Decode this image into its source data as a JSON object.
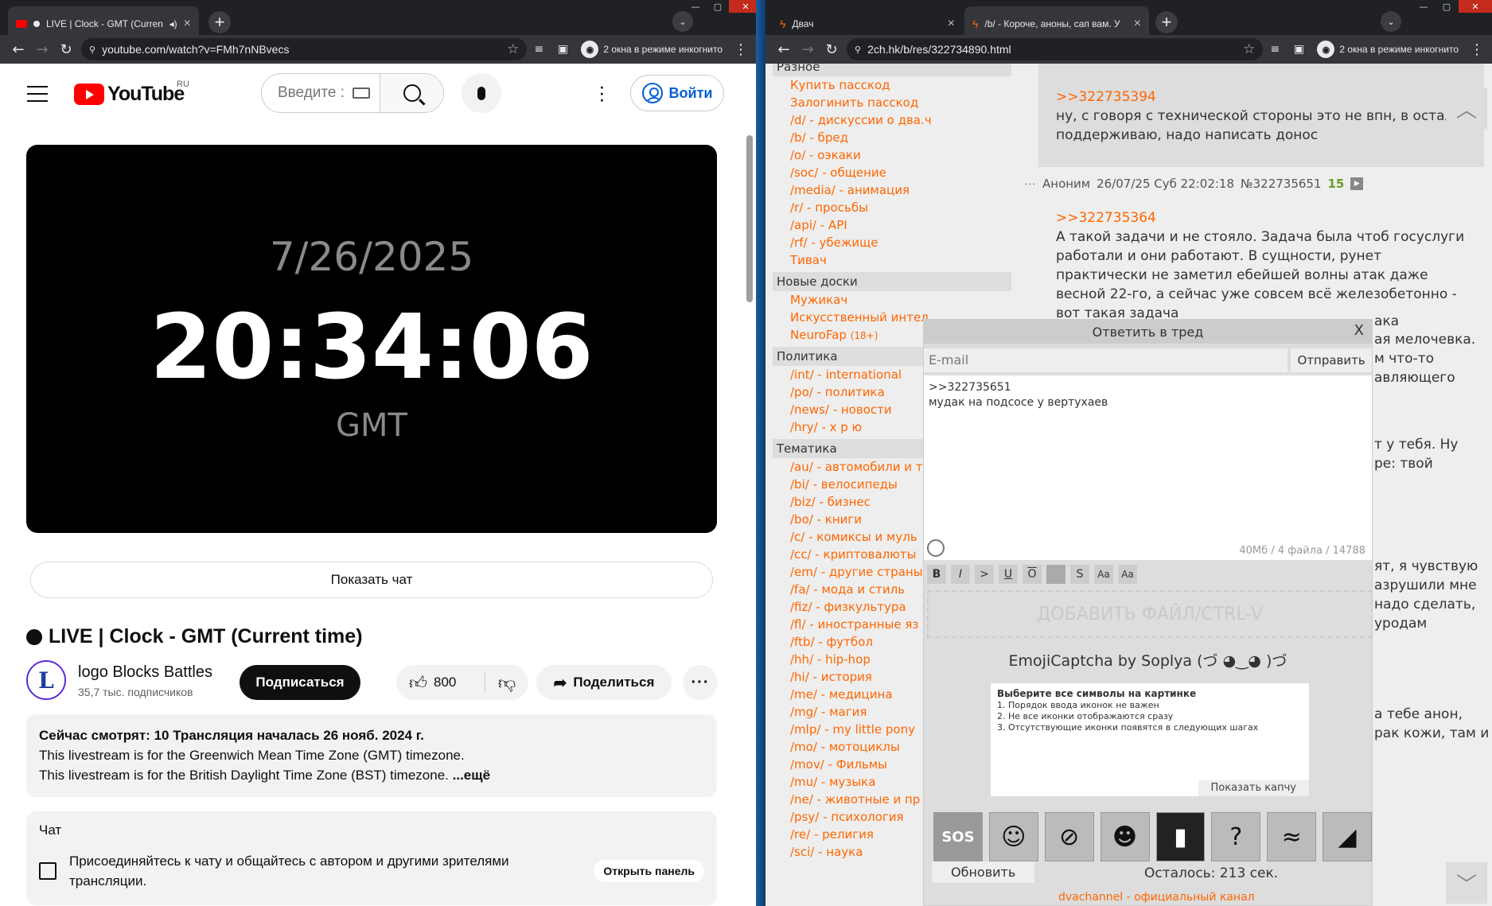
{
  "left_window": {
    "tab_title": "LIVE | Clock - GMT (Current time)",
    "address": "youtube.com/watch?v=FMh7nNBvecs",
    "incognito": "2 окна в режиме инкогнито",
    "youtube": {
      "logo_text": "YouTube",
      "logo_region": "RU",
      "search_placeholder": "Введите :",
      "login": "Войти",
      "player": {
        "date": "7/26/2025",
        "time": "20:34:06",
        "tz": "GMT"
      },
      "show_chat": "Показать чат",
      "video_title": "LIVE | Clock - GMT (Current time)",
      "channel": {
        "avatar_letter": "L",
        "name": "logo Blocks Battles",
        "subs": "35,7 тыс. подписчиков"
      },
      "subscribe": "Подписаться",
      "likes": "800",
      "share": "Поделиться",
      "description": {
        "meta": "Сейчас смотрят: 10  Трансляция началась 26 нояб. 2024 г.",
        "line1": "This livestream is for the Greenwich Mean Time Zone (GMT) timezone.",
        "line2": "This livestream is for the British Daylight Time Zone (BST) timezone.",
        "more": "...ещё"
      },
      "chat": {
        "title": "Чат",
        "text": "Присоединяйтесь к чату и общайтесь с автором и другими зрителями трансляции.",
        "open": "Открыть панель"
      }
    }
  },
  "right_window": {
    "tabs": [
      {
        "title": "Двач"
      },
      {
        "title": "/b/ - Короче, аноны, сап вам. У"
      }
    ],
    "address": "2ch.hk/b/res/322734890.html",
    "incognito": "2 окна в режиме инкогнито",
    "sidebar": {
      "sections": [
        {
          "head": "Разное",
          "items": [
            "Купить пасскод",
            "Залогинить пасскод",
            "/d/ - дискуссии о два.ч",
            "/b/ - бред",
            "/o/ - оэкаки",
            "/soc/ - общение",
            "/media/ - анимация",
            "/r/ - просьбы",
            "/api/ - API",
            "/rf/ - убежище",
            "Тивач"
          ]
        },
        {
          "head": "Новые доски",
          "items": [
            "Мужикач",
            "Искусственный интел",
            "NeuroFap"
          ]
        },
        {
          "head": "Политика",
          "items": [
            "/int/ - international",
            "/po/ - политика",
            "/news/ - новости",
            "/hry/ - х р ю"
          ]
        },
        {
          "head": "Тематика",
          "items": [
            "/au/ - автомобили и т",
            "/bi/ - велосипеды",
            "/biz/ - бизнес",
            "/bo/ - книги",
            "/c/ - комиксы и муль",
            "/cc/ - криптовалюты",
            "/em/ - другие страны",
            "/fa/ - мода и стиль",
            "/fiz/ - физкультура",
            "/fl/ - иностранные яз",
            "/ftb/ - футбол",
            "/hh/ - hip-hop",
            "/hi/ - история",
            "/me/ - медицина",
            "/mg/ - магия",
            "/mlp/ - my little pony",
            "/mo/ - мотоциклы",
            "/mov/ - Фильмы",
            "/mu/ - музыка",
            "/ne/ - животные и пр",
            "/psy/ - психология",
            "/re/ - религия",
            "/sci/ - наука"
          ]
        }
      ],
      "neurofap_badge": "(18+)"
    },
    "post1": {
      "ref": ">>322735394",
      "text": "ну, с говоря с технической стороны это не впн, в остал поддерживаю, надо написать донос"
    },
    "post2": {
      "author": "Аноним",
      "date": "26/07/25 Суб 22:02:18",
      "num": "№322735651",
      "replies": "15",
      "ref": ">>322735364",
      "text": "А такой задачи и не стояло. Задача была чтоб госуслуги работали и они работают. В сущности, рунет практически не заметил ебейшей волны атак даже весной 22-го, а сейчас уже совсем всё железобетонно - вот такая задача"
    },
    "peeks": [
      "ака",
      "ая мелочевка.",
      "м что-то",
      "авляющего",
      "т у тебя. Ну",
      "ре: твой",
      "ят, я чувствую",
      "азрушили мне",
      " надо сделать,",
      "уродам",
      "а тебе анон,",
      "рак кожи, там и"
    ],
    "reply_form": {
      "title": "Ответить в тред",
      "close": "X",
      "email_placeholder": "E-mail",
      "send": "Отправить",
      "message_line1": ">>322735651",
      "message_line2": "мудак на подсосе у вертухаев",
      "counter": "40Мб / 4 файла / 14788",
      "format_buttons": [
        "B",
        "I",
        ">",
        "U",
        "O",
        "",
        "S",
        "Aa",
        "Aa"
      ],
      "drop": "ДОБАВИТЬ ФАЙЛ/CTRL-V",
      "captcha_title": "EmojiCaptcha by Soplya (づ ◕‿◕ )づ",
      "captcha_head": "Выберите все символы на картинке",
      "captcha_rules": [
        "1. Порядок ввода иконок не важен",
        "2. Не все иконки отображаются сразу",
        "3. Отсутствующие иконки появятся в следующих шагах"
      ],
      "show_captcha": "Показать капчу",
      "emoji_buttons": [
        "sos-icon",
        "cook-icon",
        "muted-icon",
        "face-icon",
        "signal-icon",
        "question-icon",
        "swimmer-icon",
        "ramen-icon"
      ],
      "refresh": "Обновить",
      "remaining": "Осталось: 213 сек."
    },
    "footer": "dvachannel - официальный канал"
  }
}
